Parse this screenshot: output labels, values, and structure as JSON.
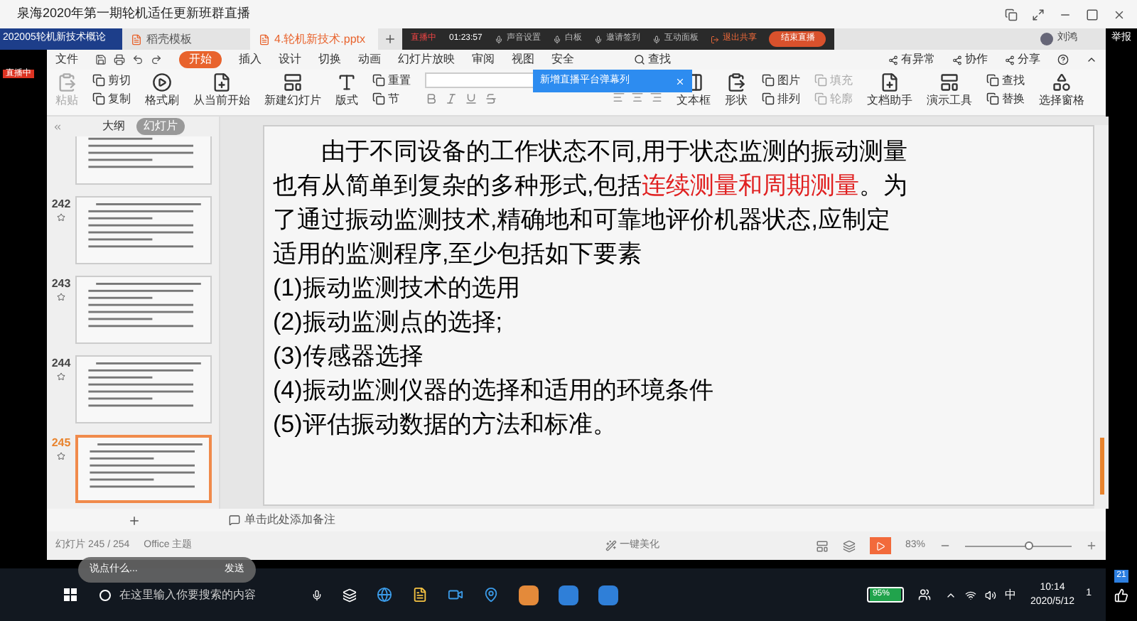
{
  "window": {
    "title": "泉海2020年第一期轮机适任更新班群直播"
  },
  "live": {
    "doc_title": "202005轮机新技术概论",
    "badge": "直播中",
    "report": "举报",
    "likes": "21"
  },
  "tabs": [
    {
      "label": "稻壳模板",
      "selected": false
    },
    {
      "label": "4.轮机新技术.pptx",
      "selected": true
    }
  ],
  "live_toolbar": {
    "status": "直播中",
    "timer": "01:23:57",
    "items": [
      "声音设置",
      "白板",
      "邀请签到",
      "互动面板"
    ],
    "share": "退出共享",
    "end": "结束直播"
  },
  "user": {
    "name": "刘鸿"
  },
  "menu": {
    "file": "文件",
    "tabs": [
      {
        "label": "开始",
        "selected": true
      },
      {
        "label": "插入",
        "selected": false
      },
      {
        "label": "设计",
        "selected": false
      },
      {
        "label": "切换",
        "selected": false
      },
      {
        "label": "动画",
        "selected": false
      },
      {
        "label": "幻灯片放映",
        "selected": false
      },
      {
        "label": "审阅",
        "selected": false
      },
      {
        "label": "视图",
        "selected": false
      },
      {
        "label": "安全",
        "selected": false
      }
    ],
    "search": "查找",
    "right": [
      "有异常",
      "协作",
      "分享"
    ]
  },
  "notice": "新增直播平台弹幕列",
  "ribbon": [
    {
      "kind": "large",
      "labels": [
        "粘贴"
      ],
      "disabled": true
    },
    {
      "kind": "stack",
      "labels": [
        "剪切",
        "复制"
      ],
      "disabled": false
    },
    {
      "kind": "large",
      "labels": [
        "格式刷"
      ],
      "disabled": false
    },
    {
      "kind": "large",
      "labels": [
        "从当前开始"
      ],
      "disabled": false
    },
    {
      "kind": "large",
      "labels": [
        "新建幻灯片"
      ],
      "disabled": false
    },
    {
      "kind": "large",
      "labels": [
        "版式"
      ],
      "disabled": false
    },
    {
      "kind": "stack",
      "labels": [
        "重置",
        "节"
      ],
      "disabled": false
    },
    {
      "kind": "font"
    },
    {
      "kind": "para"
    },
    {
      "kind": "large",
      "labels": [
        "文本框"
      ],
      "disabled": false
    },
    {
      "kind": "large",
      "labels": [
        "形状"
      ],
      "disabled": false
    },
    {
      "kind": "stack",
      "labels": [
        "图片",
        "排列"
      ],
      "disabled": false
    },
    {
      "kind": "stack",
      "labels": [
        "填充",
        "轮廓"
      ],
      "disabled": true
    },
    {
      "kind": "large",
      "labels": [
        "文档助手"
      ],
      "disabled": false
    },
    {
      "kind": "large",
      "labels": [
        "演示工具"
      ],
      "disabled": false
    },
    {
      "kind": "stack",
      "labels": [
        "查找",
        "替换"
      ],
      "disabled": false
    },
    {
      "kind": "large",
      "labels": [
        "选择窗格"
      ],
      "disabled": false
    }
  ],
  "panel": {
    "tabs": [
      {
        "label": "大纲",
        "selected": false
      },
      {
        "label": "幻灯片",
        "selected": true
      }
    ],
    "slides": [
      {
        "selected": false
      },
      {
        "number": "242",
        "selected": false
      },
      {
        "number": "243",
        "selected": false
      },
      {
        "number": "244",
        "selected": false
      },
      {
        "number": "245",
        "selected": true
      }
    ]
  },
  "slide": {
    "intro": [
      {
        "text": "由于不同设备的工作状态不同,用于状态监测的振动测量也有从简单到复杂的多种形式,包括",
        "red": false
      },
      {
        "text": "连续测量和周期测量",
        "red": true
      },
      {
        "text": "。为了通过振动监测技术,精确地和可靠地评价机器状态,应制定适用的监测程序,至少包括如下要素",
        "red": false
      }
    ],
    "items": [
      "(1)振动监测技术的选用",
      "(2)振动监测点的选择;",
      "(3)传感器选择",
      "(4)振动监测仪器的选择和适用的环境条件",
      "(5)评估振动数据的方法和标准。"
    ]
  },
  "notes": {
    "placeholder": "单击此处添加备注"
  },
  "status_bar": {
    "slide": "幻灯片 245 / 254",
    "theme": "Office 主题",
    "beautify": "一键美化",
    "zoom": "83%",
    "level": 0.6
  },
  "chat": {
    "placeholder": "说点什么...",
    "send": "发送"
  },
  "taskbar": {
    "search": "在这里输入你要搜索的内容",
    "battery": "95%",
    "ime": "中",
    "time": "10:14",
    "date": "2020/5/12",
    "notifications": "1"
  }
}
